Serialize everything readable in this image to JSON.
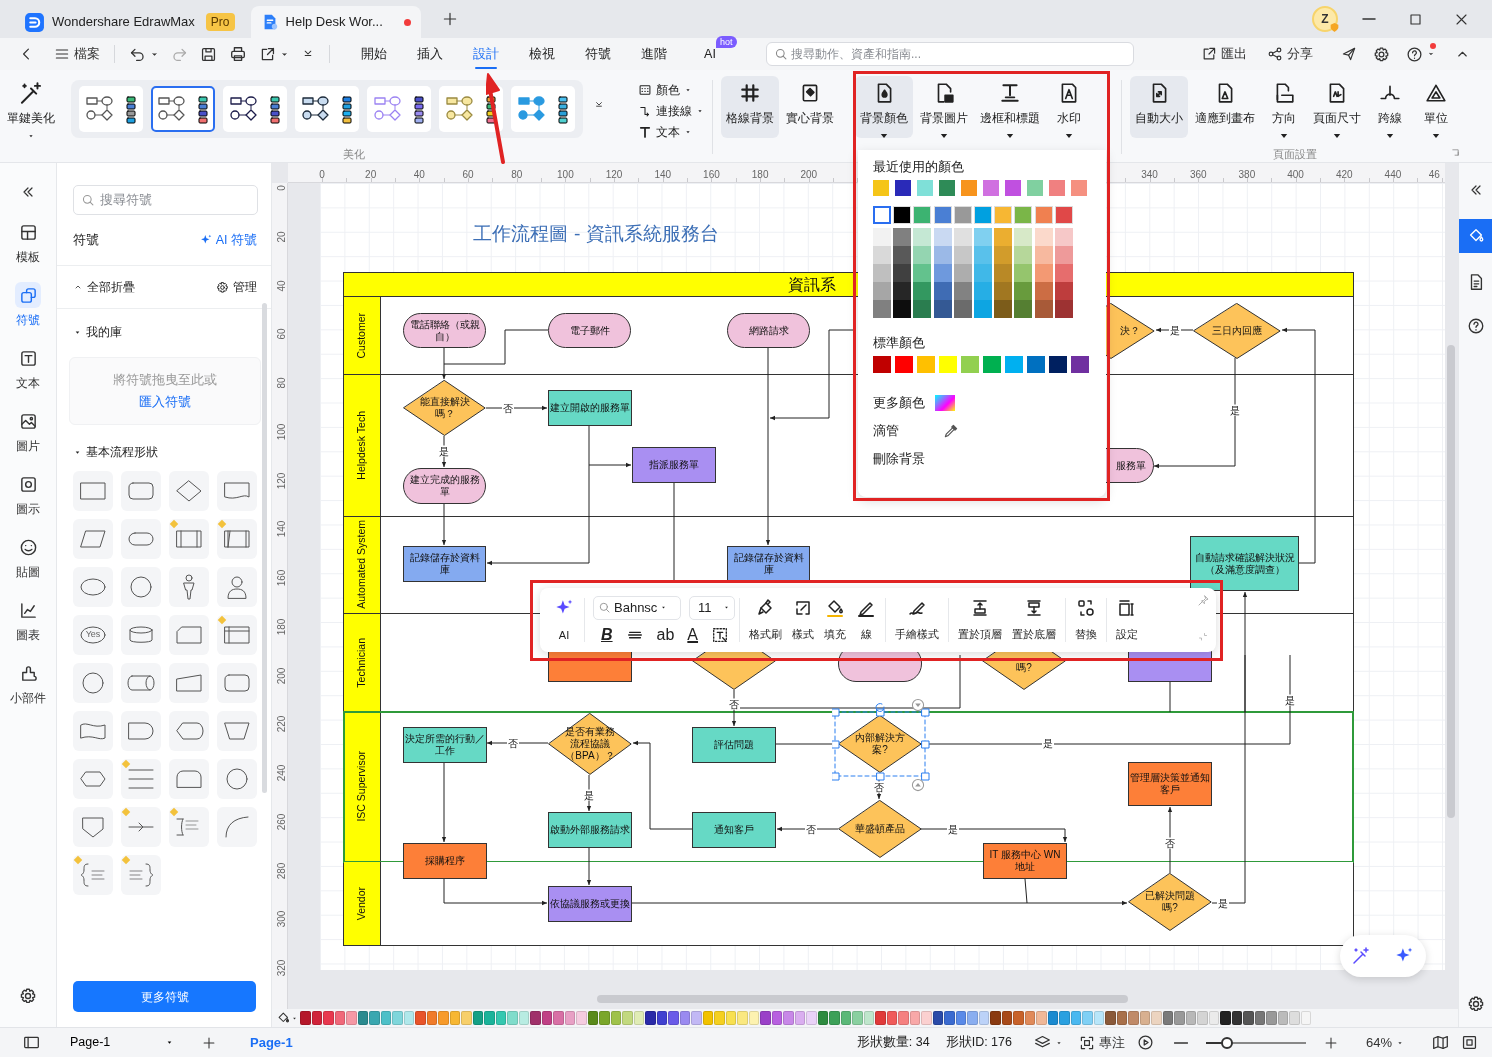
{
  "app_tabs": [
    {
      "kind": "app",
      "title": "Wondershare EdrawMax",
      "badge": "Pro",
      "selected": false
    },
    {
      "kind": "document",
      "title": "Help Desk Wor...",
      "unsaved": true,
      "selected": true
    }
  ],
  "avatar": "Z",
  "menu": {
    "file": "檔案",
    "tabs": [
      {
        "label": "開始",
        "selected": false
      },
      {
        "label": "插入",
        "selected": false
      },
      {
        "label": "設計",
        "selected": true
      },
      {
        "label": "檢視",
        "selected": false
      },
      {
        "label": "符號",
        "selected": false
      },
      {
        "label": "進階",
        "selected": false
      },
      {
        "label": "AI",
        "badge": "hot",
        "selected": false
      }
    ],
    "search": {
      "placeholder": "搜尋動作、資產和指南..."
    },
    "export": "匯出",
    "share": "分享",
    "help_notification": true
  },
  "ribbon": {
    "beautify": "單鍵美化",
    "themes": [
      {
        "selected": false
      },
      {
        "selected": true
      },
      {
        "selected": false
      },
      {
        "selected": false
      },
      {
        "selected": false
      },
      {
        "selected": false
      },
      {
        "selected": false
      }
    ],
    "theme_options": [
      {
        "kind": "color",
        "label": "顏色"
      },
      {
        "kind": "connector",
        "label": "連接線"
      },
      {
        "kind": "text",
        "label": "文本"
      }
    ],
    "beautify_group": "美化",
    "background_buttons": [
      {
        "kind": "grid",
        "label": "格線背景",
        "active": true,
        "dropdown": false
      },
      {
        "kind": "solid",
        "label": "實心背景",
        "active": false,
        "dropdown": false
      },
      {
        "kind": "bgcolor",
        "label": "背景顏色",
        "active": true,
        "dropdown": true
      },
      {
        "kind": "bgimage",
        "label": "背景圖片",
        "active": false,
        "dropdown": true
      },
      {
        "kind": "border",
        "label": "邊框和標題",
        "active": false,
        "dropdown": true
      },
      {
        "kind": "watermark",
        "label": "水印",
        "active": false,
        "dropdown": true
      }
    ],
    "page_buttons": [
      {
        "kind": "autosize",
        "label": "自動大小",
        "active": true,
        "dropdown": false
      },
      {
        "kind": "fit",
        "label": "適應到畫布",
        "active": false,
        "dropdown": false
      },
      {
        "kind": "orientation",
        "label": "方向",
        "active": false,
        "dropdown": true
      },
      {
        "kind": "pagesize",
        "label": "頁面尺寸",
        "active": false,
        "dropdown": true
      },
      {
        "kind": "jump",
        "label": "跨線",
        "active": false,
        "dropdown": true
      },
      {
        "kind": "unit",
        "label": "單位",
        "active": false,
        "dropdown": true
      }
    ],
    "page_group": "頁面設置"
  },
  "left_rail": [
    {
      "kind": "templates",
      "label": "模板",
      "selected": false
    },
    {
      "kind": "symbols",
      "label": "符號",
      "selected": true
    },
    {
      "kind": "text",
      "label": "文本",
      "selected": false
    },
    {
      "kind": "images",
      "label": "圖片",
      "selected": false
    },
    {
      "kind": "icons",
      "label": "圖示",
      "selected": false
    },
    {
      "kind": "stickers",
      "label": "貼圖",
      "selected": false
    },
    {
      "kind": "charts",
      "label": "圖表",
      "selected": false
    },
    {
      "kind": "widgets",
      "label": "小部件",
      "selected": false
    }
  ],
  "symbols_panel": {
    "search": {
      "placeholder": "搜尋符號"
    },
    "title": "符號",
    "ai_link": "AI 符號",
    "collapse_all": "全部折疊",
    "manage": "管理",
    "library": {
      "title": "我的庫",
      "expanded": true
    },
    "dropzone": {
      "text": "將符號拖曳至此或",
      "link": "匯入符號"
    },
    "shapes_section": {
      "title": "基本流程形狀",
      "expanded": true
    },
    "shapes": [
      {
        "kind": "rect",
        "marked": false
      },
      {
        "kind": "rounded",
        "marked": false
      },
      {
        "kind": "diamond",
        "marked": false
      },
      {
        "kind": "document",
        "marked": false
      },
      {
        "kind": "parallelogram",
        "marked": false
      },
      {
        "kind": "stadium",
        "marked": false
      },
      {
        "kind": "predefined",
        "marked": true
      },
      {
        "kind": "subprocess",
        "marked": true
      },
      {
        "kind": "ellipse",
        "marked": false
      },
      {
        "kind": "circle",
        "marked": false
      },
      {
        "kind": "figure",
        "marked": false
      },
      {
        "kind": "person",
        "marked": false
      },
      {
        "kind": "ellipse",
        "text": "Yes",
        "marked": false
      },
      {
        "kind": "cylinder",
        "marked": false
      },
      {
        "kind": "card",
        "marked": false
      },
      {
        "kind": "storage",
        "marked": true
      },
      {
        "kind": "circle",
        "marked": false
      },
      {
        "kind": "drum",
        "marked": false
      },
      {
        "kind": "manual",
        "marked": false
      },
      {
        "kind": "rounded",
        "marked": false
      },
      {
        "kind": "wave",
        "marked": false
      },
      {
        "kind": "delay",
        "marked": false
      },
      {
        "kind": "display",
        "marked": false
      },
      {
        "kind": "trapezoid",
        "marked": false
      },
      {
        "kind": "hexagon",
        "marked": false
      },
      {
        "kind": "lines",
        "marked": true
      },
      {
        "kind": "roundtop",
        "marked": false
      },
      {
        "kind": "circle",
        "marked": false
      },
      {
        "kind": "offpage",
        "marked": false
      },
      {
        "kind": "arrowline",
        "marked": true
      },
      {
        "kind": "note",
        "marked": true
      },
      {
        "kind": "arc",
        "marked": false
      },
      {
        "kind": "braceleft",
        "marked": true
      },
      {
        "kind": "braceright",
        "marked": true
      }
    ],
    "more_button": "更多符號"
  },
  "canvas": {
    "h_ruler": [
      "0",
      "20",
      "40",
      "60",
      "80",
      "100",
      "120",
      "140",
      "160",
      "180",
      "200",
      "340",
      "360",
      "380",
      "400",
      "420",
      "440",
      "46"
    ],
    "v_ruler": [
      "0",
      "20",
      "40",
      "60",
      "80",
      "100",
      "120",
      "140",
      "160",
      "180",
      "200",
      "220",
      "240",
      "260",
      "280",
      "300",
      "320"
    ],
    "title": "工作流程圖 - 資訊系統服務台",
    "pool": {
      "title": "資訊系",
      "lanes": [
        {
          "label": "Customer",
          "outlined": false
        },
        {
          "label": "Helpdesk Tech",
          "outlined": false
        },
        {
          "label": "Automated System",
          "outlined": false
        },
        {
          "label": "Technician",
          "outlined": false
        },
        {
          "label": "ISC Supervisor",
          "outlined": true
        },
        {
          "label": "Vendor",
          "outlined": false
        }
      ]
    },
    "nodes": [
      {
        "kind": "terminator",
        "text": "電話聯絡（或親自）",
        "color": "#f0c2dc",
        "selected": false
      },
      {
        "kind": "terminator",
        "text": "電子郵件",
        "color": "#f0c2dc",
        "selected": false
      },
      {
        "kind": "terminator",
        "text": "網路請求",
        "color": "#f0c2dc",
        "selected": false
      },
      {
        "kind": "decision",
        "text": "決？",
        "color": "#fdc35a",
        "selected": false
      },
      {
        "kind": "decision",
        "text": "三日內回應",
        "color": "#fdc35a",
        "selected": false
      },
      {
        "kind": "decision",
        "text": "能直接解決嗎？",
        "color": "#fdc35a",
        "selected": false
      },
      {
        "kind": "process",
        "text": "建立開啟的服務單",
        "color": "#66d9c5",
        "selected": false
      },
      {
        "kind": "terminator",
        "text": "建立完成的服務單",
        "color": "#f0c2dc",
        "selected": false
      },
      {
        "kind": "process",
        "text": "指派服務單",
        "color": "#a98ff2",
        "selected": false
      },
      {
        "kind": "terminator",
        "text": "服務單",
        "color": "#f0c2dc",
        "selected": false
      },
      {
        "kind": "process",
        "text": "記錄儲存於資料庫",
        "color": "#84aaf0",
        "selected": false
      },
      {
        "kind": "process",
        "text": "記錄儲存於資料庫",
        "color": "#84aaf0",
        "selected": false
      },
      {
        "kind": "process",
        "text": "自動請求確認解決狀況（及滿意度調查）",
        "color": "#66d9c5",
        "selected": false
      },
      {
        "kind": "process",
        "color": "#fd7f38",
        "selected": false
      },
      {
        "kind": "decision",
        "color": "#fdc35a",
        "selected": false
      },
      {
        "kind": "terminator",
        "color": "#f0c2dc",
        "selected": false
      },
      {
        "kind": "decision",
        "text": "嗎?",
        "color": "#fdc35a",
        "selected": false
      },
      {
        "kind": "process",
        "color": "#a98ff2",
        "selected": false
      },
      {
        "kind": "process",
        "text": "決定所需的行動／工作",
        "color": "#66d9c5",
        "selected": false
      },
      {
        "kind": "decision",
        "text": "是否有業務流程協議（BPA）？",
        "color": "#fdc35a",
        "selected": false
      },
      {
        "kind": "process",
        "text": "評估問題",
        "color": "#66d9c5",
        "selected": false
      },
      {
        "kind": "decision",
        "text": "內部解決方案?",
        "color": "#fdc35a",
        "selected": true
      },
      {
        "kind": "process",
        "text": "管理層決策並通知客戶",
        "color": "#fd7f38",
        "selected": false
      },
      {
        "kind": "process",
        "text": "啟動外部服務請求",
        "color": "#66d9c5",
        "selected": false
      },
      {
        "kind": "process",
        "text": "通知客戶",
        "color": "#66d9c5",
        "selected": false
      },
      {
        "kind": "decision",
        "text": "華盛頓產品",
        "color": "#fdc35a",
        "selected": false
      },
      {
        "kind": "process",
        "text": "採購程序",
        "color": "#fd7f38",
        "selected": false
      },
      {
        "kind": "process",
        "text": "IT 服務中心 WN 地址",
        "color": "#fd7f38",
        "selected": false
      },
      {
        "kind": "process",
        "text": "依協議服務或更換",
        "color": "#a98ff2",
        "selected": false
      },
      {
        "kind": "decision",
        "text": "已解決問題嗎?",
        "color": "#fdc35a",
        "selected": false
      }
    ],
    "edge_labels": [
      "否",
      "是",
      "是",
      "是",
      "否",
      "否",
      "是",
      "是",
      "是",
      "否",
      "否",
      "是",
      "否",
      "是"
    ]
  },
  "floating_toolbar": {
    "ai": "AI",
    "font": "Bahnsc",
    "size": "11",
    "format": [
      {
        "kind": "bold",
        "text": "B"
      },
      {
        "kind": "strike"
      },
      {
        "kind": "case",
        "text": "ab"
      },
      {
        "kind": "font_color",
        "text": "A"
      },
      {
        "kind": "textbox"
      }
    ],
    "tools": [
      {
        "kind": "painter",
        "label": "格式刷"
      },
      {
        "kind": "style",
        "label": "樣式"
      },
      {
        "kind": "fill",
        "label": "填充"
      },
      {
        "kind": "line",
        "label": "線"
      },
      {
        "kind": "sketch",
        "label": "手繪樣式"
      },
      {
        "kind": "front",
        "label": "置於頂層"
      },
      {
        "kind": "back",
        "label": "置於底層"
      },
      {
        "kind": "replace",
        "label": "替換"
      },
      {
        "kind": "settings",
        "label": "設定"
      }
    ]
  },
  "color_panel": {
    "recent_title": "最近使用的顏色",
    "recent": [
      {
        "color": "#f5c518"
      },
      {
        "color": "#2a2ab8"
      },
      {
        "color": "#7fe0d8"
      },
      {
        "color": "#2e8b57"
      },
      {
        "color": "#f7941d"
      },
      {
        "color": "#d070e0"
      },
      {
        "color": "#c050e0"
      },
      {
        "color": "#80d0a0"
      },
      {
        "color": "#f08080"
      },
      {
        "color": "#f59080"
      }
    ],
    "theme": [
      {
        "color": "#ffffff",
        "selected": true
      },
      {
        "color": "#000000",
        "selected": false
      },
      {
        "color": "#3cb371",
        "selected": false
      },
      {
        "color": "#4a7fd4",
        "selected": false
      },
      {
        "color": "#999999",
        "selected": false
      },
      {
        "color": "#00a0e0",
        "selected": false
      },
      {
        "color": "#f7b733",
        "selected": false
      },
      {
        "color": "#7ab648",
        "selected": false
      },
      {
        "color": "#f08050",
        "selected": false
      },
      {
        "color": "#e04848",
        "selected": false
      }
    ],
    "standard_title": "標準顏色",
    "standard": [
      {
        "color": "#c00000"
      },
      {
        "color": "#ff0000"
      },
      {
        "color": "#ffc000"
      },
      {
        "color": "#ffff00"
      },
      {
        "color": "#92d050"
      },
      {
        "color": "#00b050"
      },
      {
        "color": "#00b0f0"
      },
      {
        "color": "#0070c0"
      },
      {
        "color": "#002060"
      },
      {
        "color": "#7030a0"
      }
    ],
    "more": "更多顏色",
    "eyedropper": "滴管",
    "remove": "刪除背景"
  },
  "palette": [
    {
      "color": "#b5172a"
    },
    {
      "color": "#d0233a"
    },
    {
      "color": "#e8384f"
    },
    {
      "color": "#f0687a"
    },
    {
      "color": "#f598a5"
    },
    {
      "color": "#2a8a8f"
    },
    {
      "color": "#39a7b0"
    },
    {
      "color": "#4dc0c8"
    },
    {
      "color": "#7fd6db"
    },
    {
      "color": "#b0e8eb"
    },
    {
      "color": "#e8542a"
    },
    {
      "color": "#f07b2a"
    },
    {
      "color": "#f79a2a"
    },
    {
      "color": "#f7b733"
    },
    {
      "color": "#f7cf6a"
    },
    {
      "color": "#14a085"
    },
    {
      "color": "#1ab39a"
    },
    {
      "color": "#35c8b0"
    },
    {
      "color": "#80dccb"
    },
    {
      "color": "#b8ece2"
    },
    {
      "color": "#a0306a"
    },
    {
      "color": "#c04085"
    },
    {
      "color": "#d870a5"
    },
    {
      "color": "#e8a0c5"
    },
    {
      "color": "#f5cce0"
    },
    {
      "color": "#5a8a1a"
    },
    {
      "color": "#7aa62a"
    },
    {
      "color": "#9fc24a"
    },
    {
      "color": "#c2d97f"
    },
    {
      "color": "#e0ecb5"
    },
    {
      "color": "#2a2aa8"
    },
    {
      "color": "#4040d0"
    },
    {
      "color": "#6a5ae8"
    },
    {
      "color": "#9a8af0"
    },
    {
      "color": "#c2b8f5"
    },
    {
      "color": "#f2c200"
    },
    {
      "color": "#f5d020"
    },
    {
      "color": "#f8e050"
    },
    {
      "color": "#fae880"
    },
    {
      "color": "#fdf2b0"
    },
    {
      "color": "#9a40c8"
    },
    {
      "color": "#b860e0"
    },
    {
      "color": "#c888e8"
    },
    {
      "color": "#daaef0"
    },
    {
      "color": "#ead2f8"
    },
    {
      "color": "#2e8b40"
    },
    {
      "color": "#3ca058"
    },
    {
      "color": "#5ab878"
    },
    {
      "color": "#8ad0a0"
    },
    {
      "color": "#bfe6cc"
    },
    {
      "color": "#e03a3a"
    },
    {
      "color": "#f05a5a"
    },
    {
      "color": "#f58080"
    },
    {
      "color": "#f8a8a8"
    },
    {
      "color": "#fbd0d0"
    },
    {
      "color": "#2a4aa8"
    },
    {
      "color": "#3a6ad0"
    },
    {
      "color": "#5a8ae8"
    },
    {
      "color": "#8aaef0"
    },
    {
      "color": "#bcd2f8"
    },
    {
      "color": "#8a3a10"
    },
    {
      "color": "#a84a1a"
    },
    {
      "color": "#c8622a"
    },
    {
      "color": "#e08a5a"
    },
    {
      "color": "#f0b898"
    },
    {
      "color": "#1a8ad0"
    },
    {
      "color": "#2aa0e0"
    },
    {
      "color": "#4ab8f0"
    },
    {
      "color": "#80d0f5"
    },
    {
      "color": "#b8e6fa"
    },
    {
      "color": "#8a5a3a"
    },
    {
      "color": "#a8704a"
    },
    {
      "color": "#c08a68"
    },
    {
      "color": "#d8b090"
    },
    {
      "color": "#ecd4c0"
    },
    {
      "color": "#7a7a7a"
    },
    {
      "color": "#999999"
    },
    {
      "color": "#b8b8b8"
    },
    {
      "color": "#d4d4d4"
    },
    {
      "color": "#ebebeb"
    },
    {
      "color": "#222222"
    },
    {
      "color": "#333333"
    },
    {
      "color": "#555555"
    },
    {
      "color": "#777777"
    },
    {
      "color": "#999999"
    },
    {
      "color": "#bbbbbb"
    },
    {
      "color": "#dddddd"
    },
    {
      "color": "#f5f5f5"
    }
  ],
  "status_bar": {
    "page_select": "Page-1",
    "page_tab": "Page-1",
    "shape_count": "形狀數量: 34",
    "shape_id": "形狀ID: 176",
    "focus": "專注",
    "zoom": {
      "level": 0.22
    },
    "zoom_text": "64%"
  }
}
